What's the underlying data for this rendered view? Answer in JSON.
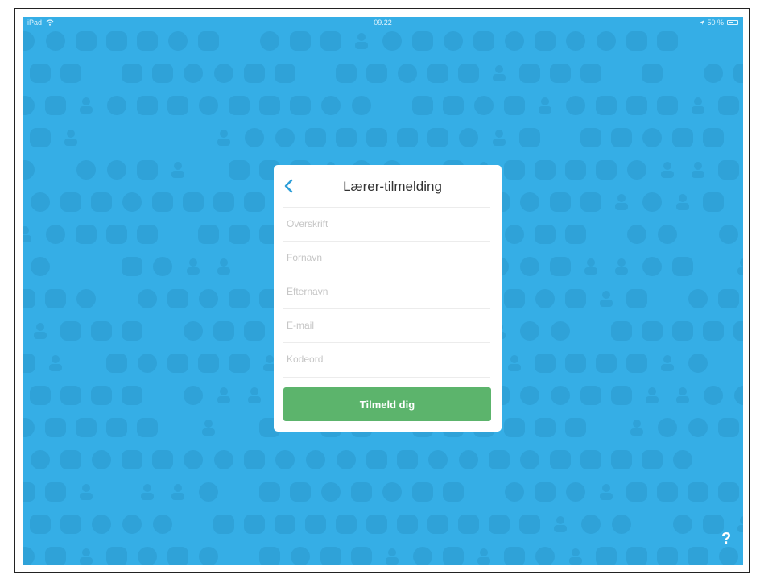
{
  "status_bar": {
    "device": "iPad",
    "time": "09.22",
    "battery": "50 %",
    "battery_level": 0.5
  },
  "signup_card": {
    "title": "Lærer-tilmelding",
    "fields": [
      {
        "placeholder": "Overskrift",
        "value": ""
      },
      {
        "placeholder": "Fornavn",
        "value": ""
      },
      {
        "placeholder": "Efternavn",
        "value": ""
      },
      {
        "placeholder": "E-mail",
        "value": ""
      },
      {
        "placeholder": "Kodeord",
        "value": ""
      }
    ],
    "submit_label": "Tilmeld dig"
  },
  "help": {
    "label": "?"
  },
  "colors": {
    "background": "#35aee6",
    "pattern": "#2fa2d8",
    "card": "#ffffff",
    "accent": "#2f9fd8",
    "submit": "#5cb46c"
  },
  "icons": {
    "back": "chevron-left-icon",
    "wifi": "wifi-icon",
    "location": "location-icon",
    "battery": "battery-icon"
  }
}
